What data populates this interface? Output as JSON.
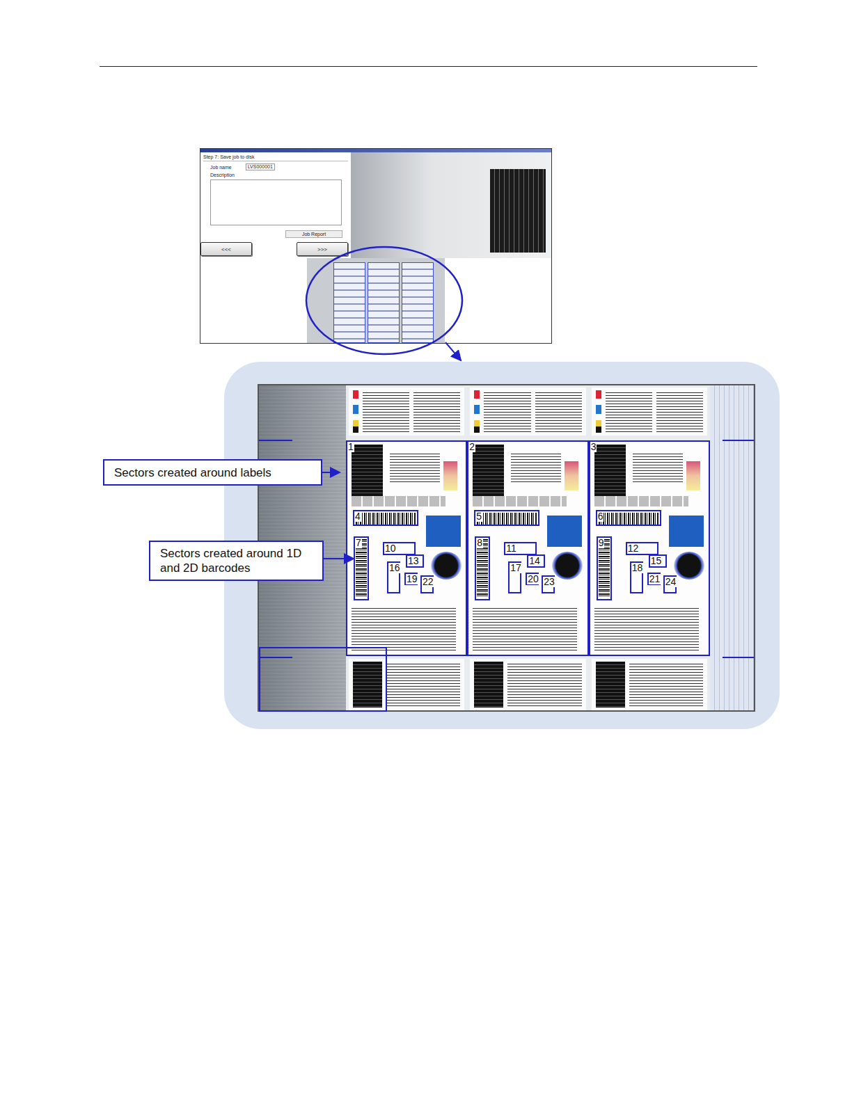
{
  "dialog": {
    "step": "Step 7: Save job to disk",
    "job_name_label": "Job name",
    "job_name_value": "LVS000001",
    "description_label": "Description",
    "job_report_button": "Job Report",
    "back_button": "<<<",
    "next_button": ">>>"
  },
  "callouts": [
    {
      "text": "Sectors created around labels"
    },
    {
      "text": "Sectors created around 1D and 2D barcodes"
    }
  ],
  "labels": [
    {
      "sector": "1",
      "barcode_sectors": [
        "4",
        "7",
        "10",
        "13",
        "16",
        "19",
        "22"
      ]
    },
    {
      "sector": "2",
      "barcode_sectors": [
        "5",
        "8",
        "11",
        "14",
        "17",
        "20",
        "23"
      ]
    },
    {
      "sector": "3",
      "barcode_sectors": [
        "6",
        "9",
        "12",
        "15",
        "18",
        "21",
        "24"
      ]
    }
  ]
}
